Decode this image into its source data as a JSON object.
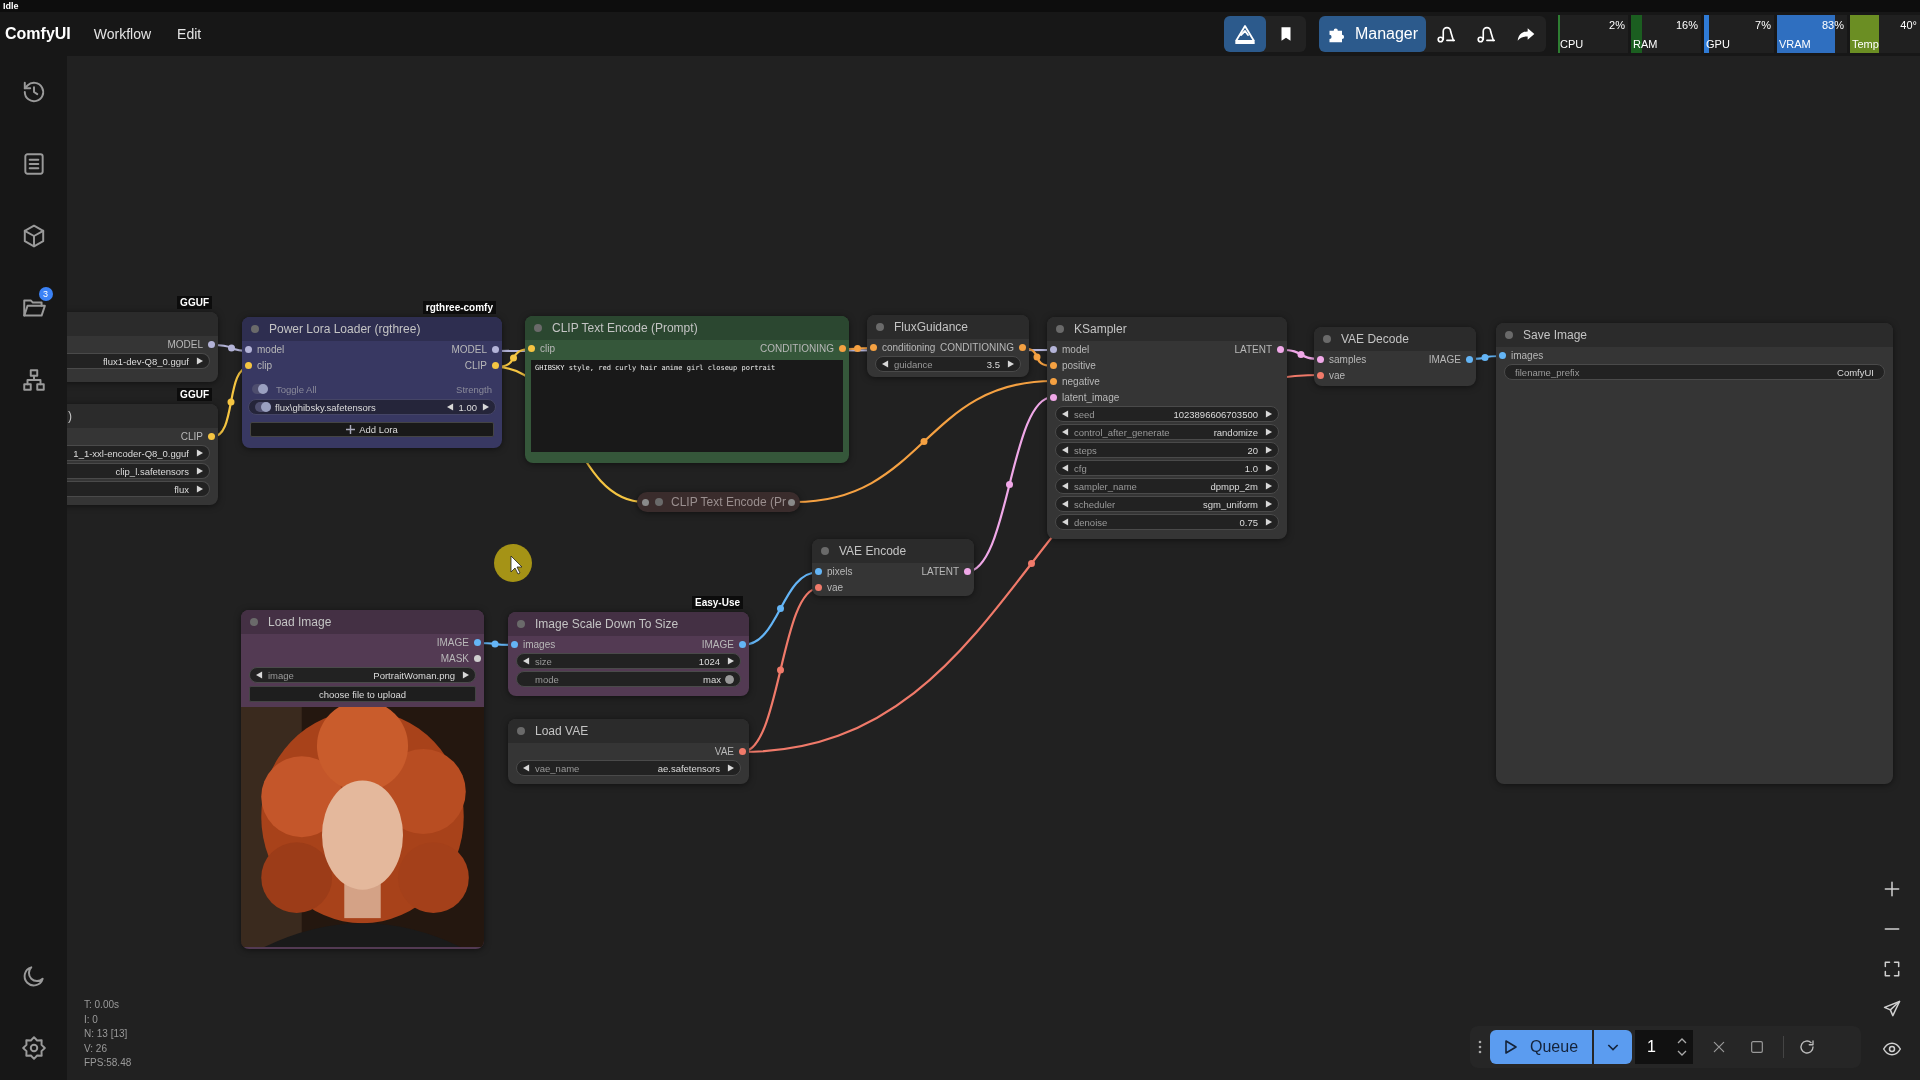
{
  "status": "Idle",
  "menu": {
    "app_name": "ComfyUI",
    "items": [
      "Workflow",
      "Edit"
    ]
  },
  "toolbar": {
    "manager": "Manager"
  },
  "monitors": [
    {
      "label": "CPU",
      "reading": "2%",
      "level": 0.02,
      "color": "#2e7d32"
    },
    {
      "label": "RAM",
      "reading": "16%",
      "level": 0.16,
      "color": "#1b5e20"
    },
    {
      "label": "GPU",
      "reading": "7%",
      "level": 0.07,
      "color": "#2f7bd6"
    },
    {
      "label": "VRAM",
      "reading": "83%",
      "level": 0.83,
      "color": "#2f6fc0"
    },
    {
      "label": "Temp",
      "reading": "40°",
      "level": 0.42,
      "color": "#6b8e23"
    }
  ],
  "sidebar": {
    "workflows_badge": "3"
  },
  "nodes": [
    {
      "color": "#353535",
      "badge": "GGUF",
      "outputs": [
        {
          "name": "MODEL",
          "color": "#b4b4d8"
        }
      ],
      "widgets": [
        {
          "kind": "combo",
          "value": "flux1-dev-Q8_0.gguf"
        }
      ]
    },
    {
      "title": ")",
      "color": "#353535",
      "badge": "GGUF",
      "outputs": [
        {
          "name": "CLIP",
          "color": "#f5c542"
        }
      ],
      "widgets": [
        {
          "kind": "combo",
          "value": "1_1-xxl-encoder-Q8_0.gguf"
        },
        {
          "kind": "combo",
          "value": "clip_l.safetensors"
        },
        {
          "kind": "combo",
          "value": "flux"
        }
      ]
    },
    {
      "title": "Power Lora Loader (rgthree)",
      "color": "#383862",
      "badge": "rgthree-comfy",
      "inputs": [
        {
          "name": "model",
          "color": "#b4b4d8"
        },
        {
          "name": "clip",
          "color": "#f5c542"
        }
      ],
      "outputs": [
        {
          "name": "MODEL",
          "color": "#b4b4d8"
        },
        {
          "name": "CLIP",
          "color": "#f5c542"
        }
      ],
      "widgets": [
        {
          "kind": "header",
          "label": "Toggle All",
          "value": "Strength",
          "on": true
        },
        {
          "kind": "lora",
          "label": "flux\\ghibsky.safetensors",
          "value": "1.00",
          "on": true
        },
        {
          "kind": "add",
          "label": "Add Lora"
        }
      ]
    },
    {
      "title": "CLIP Text Encode (Prompt)",
      "color": "#35573a",
      "inputs": [
        {
          "name": "clip",
          "color": "#f5c542"
        }
      ],
      "outputs": [
        {
          "name": "CONDITIONING",
          "color": "#f5a142"
        }
      ],
      "widgets": [
        {
          "kind": "textarea",
          "value": "GHIBSKY style, red curly hair anime girl closeup portrait"
        }
      ]
    },
    {
      "title": "CLIP Text Encode (Pr",
      "color": "#3a2c2c",
      "collapsed": true
    },
    {
      "title": "FluxGuidance",
      "color": "#353535",
      "inputs": [
        {
          "name": "conditioning",
          "color": "#f5a142"
        }
      ],
      "outputs": [
        {
          "name": "CONDITIONING",
          "color": "#f5a142"
        }
      ],
      "widgets": [
        {
          "kind": "combo",
          "label": "guidance",
          "value": "3.5"
        }
      ]
    },
    {
      "title": "KSampler",
      "color": "#353535",
      "inputs": [
        {
          "name": "model",
          "color": "#b4b4d8"
        },
        {
          "name": "positive",
          "color": "#f5a142"
        },
        {
          "name": "negative",
          "color": "#f5a142"
        },
        {
          "name": "latent_image",
          "color": "#f0a8e8"
        }
      ],
      "outputs": [
        {
          "name": "LATENT",
          "color": "#f0a8e8"
        }
      ],
      "widgets": [
        {
          "kind": "combo",
          "label": "seed",
          "value": "1023896606703500"
        },
        {
          "kind": "combo",
          "label": "control_after_generate",
          "value": "randomize"
        },
        {
          "kind": "combo",
          "label": "steps",
          "value": "20"
        },
        {
          "kind": "combo",
          "label": "cfg",
          "value": "1.0"
        },
        {
          "kind": "combo",
          "label": "sampler_name",
          "value": "dpmpp_2m"
        },
        {
          "kind": "combo",
          "label": "scheduler",
          "value": "sgm_uniform"
        },
        {
          "kind": "combo",
          "label": "denoise",
          "value": "0.75"
        }
      ]
    },
    {
      "title": "VAE Decode",
      "color": "#353535",
      "inputs": [
        {
          "name": "samples",
          "color": "#f0a8e8"
        },
        {
          "name": "vae",
          "color": "#f07a6a"
        }
      ],
      "outputs": [
        {
          "name": "IMAGE",
          "color": "#64b5f6"
        }
      ]
    },
    {
      "title": "Save Image",
      "color": "#353535",
      "inputs": [
        {
          "name": "images",
          "color": "#64b5f6"
        }
      ],
      "widgets": [
        {
          "kind": "text",
          "label": "filename_prefix",
          "value": "ComfyUI"
        }
      ]
    },
    {
      "title": "VAE Encode",
      "color": "#353535",
      "inputs": [
        {
          "name": "pixels",
          "color": "#64b5f6"
        },
        {
          "name": "vae",
          "color": "#f07a6a"
        }
      ],
      "outputs": [
        {
          "name": "LATENT",
          "color": "#f0a8e8"
        }
      ]
    },
    {
      "title": "Load Image",
      "color": "#533a53",
      "outputs": [
        {
          "name": "IMAGE",
          "color": "#64b5f6"
        },
        {
          "name": "MASK",
          "color": "#cfcfcf"
        }
      ],
      "widgets": [
        {
          "kind": "combo",
          "label": "image",
          "value": "PortraitWoman.png"
        },
        {
          "kind": "button",
          "label": "choose file to upload"
        }
      ],
      "preview": {
        "kind": "picture"
      }
    },
    {
      "title": "Image Scale Down To Size",
      "color": "#533a53",
      "badge": "Easy-Use",
      "inputs": [
        {
          "name": "images",
          "color": "#64b5f6"
        }
      ],
      "outputs": [
        {
          "name": "IMAGE",
          "color": "#64b5f6"
        }
      ],
      "widgets": [
        {
          "kind": "combo",
          "label": "size",
          "value": "1024"
        },
        {
          "kind": "toggle",
          "label": "mode",
          "value": "max",
          "on": true
        }
      ]
    },
    {
      "title": "Load VAE",
      "color": "#353535",
      "outputs": [
        {
          "name": "VAE",
          "color": "#f07a6a"
        }
      ],
      "widgets": [
        {
          "kind": "combo",
          "label": "vae_name",
          "value": "ae.safetensors"
        }
      ]
    }
  ],
  "stats": [
    "T: 0.00s",
    "I: 0",
    "N: 13 [13]",
    "V: 26",
    "FPS:58.48"
  ],
  "queue": {
    "label": "Queue",
    "count": "1"
  }
}
